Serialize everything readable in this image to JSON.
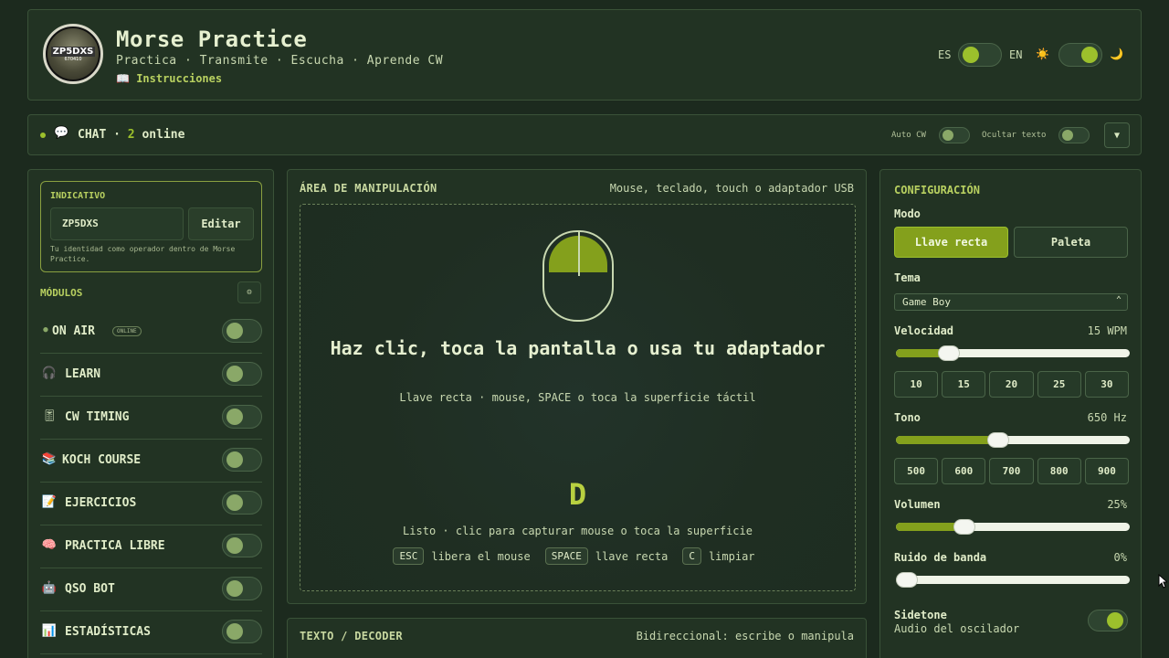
{
  "header": {
    "logo_text": "ZP5DXS",
    "logo_sub": "670410",
    "title": "Morse Practice",
    "subtitle": "Practica · Transmite · Escucha · Aprende CW",
    "instructions_icon": "book-icon",
    "instructions": "Instrucciones",
    "lang_left": "ES",
    "lang_right": "EN",
    "sun_icon": "☀️",
    "moon_icon": "🌙"
  },
  "chat": {
    "label": "CHAT · ",
    "online_count": "2",
    "online_suffix": " online",
    "auto_cw": "Auto CW",
    "hide_text": "Ocultar texto",
    "expand_icon": "▼"
  },
  "callsign": {
    "title": "INDICATIVO",
    "value": "ZP5DXS",
    "edit": "Editar",
    "help": "Tu identidad como operador dentro de Morse Practice."
  },
  "modules": {
    "title": "MÓDULOS",
    "gear": "⚙",
    "items": [
      {
        "icon": "●",
        "name": "ON AIR",
        "badge": "ONLINE"
      },
      {
        "icon": "🎧",
        "name": "LEARN"
      },
      {
        "icon": "🎚",
        "name": "CW TIMING"
      },
      {
        "icon": "📚",
        "name": "KOCH COURSE"
      },
      {
        "icon": "📝",
        "name": "EJERCICIOS"
      },
      {
        "icon": "🧠",
        "name": "PRACTICA LIBRE"
      },
      {
        "icon": "🤖",
        "name": "QSO BOT"
      },
      {
        "icon": "📊",
        "name": "ESTADÍSTICAS"
      }
    ]
  },
  "manip": {
    "title": "ÁREA DE MANIPULACIÓN",
    "inputs": "Mouse, teclado, touch o adaptador USB",
    "prompt": "Haz clic, toca la pantalla o usa tu adaptador",
    "hint": "Llave recta · mouse, SPACE o toca la superficie táctil",
    "letter": "D",
    "status": "Listo · clic para capturar mouse o toca la superficie",
    "key_esc": "ESC",
    "key_esc_desc": "libera el mouse",
    "key_space": "SPACE",
    "key_space_desc": "llave recta",
    "key_c": "C",
    "key_c_desc": "limpiar"
  },
  "decoder": {
    "title": "TEXTO / DECODER",
    "desc": "Bidireccional: escribe o manipula"
  },
  "config": {
    "title": "CONFIGURACIÓN",
    "mode_label": "Modo",
    "mode_straight": "Llave recta",
    "mode_paddle": "Paleta",
    "theme_label": "Tema",
    "theme_value": "Game Boy",
    "speed_label": "Velocidad",
    "speed_value": "15 WPM",
    "speed_fraction": 0.2,
    "speed_presets": [
      "10",
      "15",
      "20",
      "25",
      "30"
    ],
    "tone_label": "Tono",
    "tone_value": "650 Hz",
    "tone_fraction": 0.43,
    "tone_presets": [
      "500",
      "600",
      "700",
      "800",
      "900"
    ],
    "volume_label": "Volumen",
    "volume_value": "25%",
    "volume_fraction": 0.27,
    "noise_label": "Ruido de banda",
    "noise_value": "0%",
    "noise_fraction": 0.0,
    "sidetone_label": "Sidetone",
    "sidetone_sub": "Audio del oscilador"
  },
  "colors": {
    "background": "#1c2a1e",
    "panel": "#223323",
    "accent": "#84a01c",
    "accent_text": "#b8d060"
  }
}
